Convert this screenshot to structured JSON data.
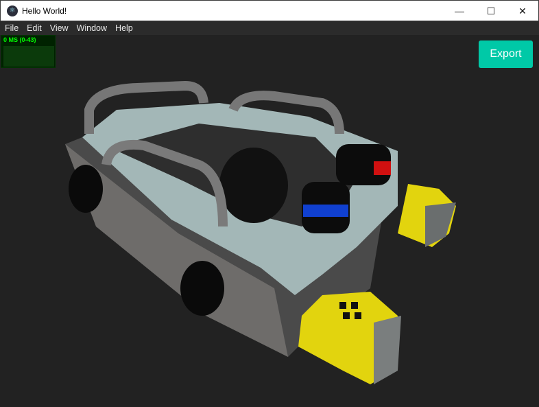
{
  "window": {
    "title": "Hello World!",
    "minimize": "—",
    "maximize": "☐",
    "close": "✕"
  },
  "menu": [
    "File",
    "Edit",
    "View",
    "Window",
    "Help"
  ],
  "stats": {
    "label": "0 MS (0-43)"
  },
  "export_label": "Export",
  "colors": {
    "accent": "#00c9a7",
    "background": "#222222",
    "body": "#9fb3b3",
    "yellow": "#e2d40e"
  }
}
